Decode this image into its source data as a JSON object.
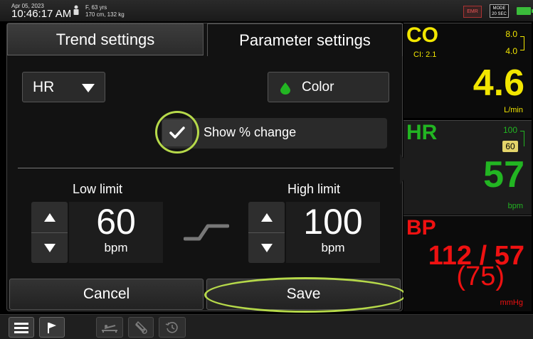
{
  "status_bar": {
    "date": "Apr 05, 2023",
    "time": "10:46:17 AM",
    "patient_line1": "F, 63 yrs",
    "patient_line2": "170 cm, 132 kg",
    "emr_label": "EMR",
    "mode_label": "MODE",
    "mode_value": "20 SEC"
  },
  "tabs": [
    {
      "label": "Trend settings",
      "active": false
    },
    {
      "label": "Parameter settings",
      "active": true
    }
  ],
  "parameter_select": {
    "selected": "HR"
  },
  "color_button": {
    "label": "Color",
    "swatch_color": "#22b522"
  },
  "show_change": {
    "label": "Show % change",
    "checked": true
  },
  "low_limit": {
    "title": "Low limit",
    "value": "60",
    "unit": "bpm"
  },
  "high_limit": {
    "title": "High limit",
    "value": "100",
    "unit": "bpm"
  },
  "actions": {
    "cancel": "Cancel",
    "save": "Save"
  },
  "highlight_color": "#b6d94a",
  "parameters": {
    "co": {
      "label": "CO",
      "ci": "CI: 2.1",
      "limit_high": "8.0",
      "limit_low": "4.0",
      "value": "4.6",
      "unit": "L/min",
      "color": "#f2e600"
    },
    "hr": {
      "label": "HR",
      "limit_high": "100",
      "limit_low": "60",
      "value": "57",
      "unit": "bpm",
      "color": "#22b522"
    },
    "bp": {
      "label": "BP",
      "value": "112 / 57",
      "mean": "(75)",
      "unit": "mmHg",
      "color": "#e11111"
    }
  },
  "toolbar_icons": [
    "menu-icon",
    "flag-icon",
    "bed-icon",
    "cuff-icon",
    "history-icon"
  ]
}
